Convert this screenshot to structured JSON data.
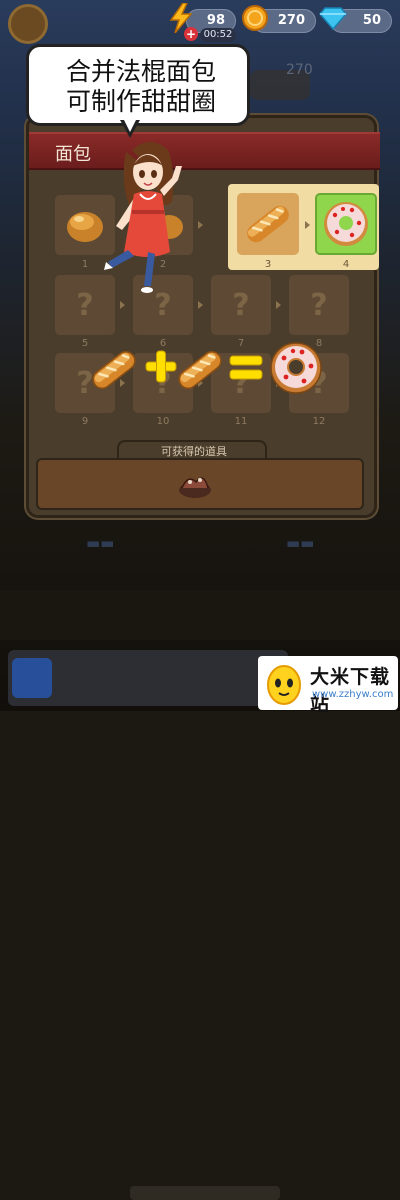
{
  "resources": {
    "energy": "98",
    "energy_timer": "00:52",
    "coins": "270",
    "gems": "50"
  },
  "background": {
    "hud_number": "270"
  },
  "panel": {
    "title": "面包",
    "slots": [
      {
        "num": "1",
        "item": "bun"
      },
      {
        "num": "2",
        "item": "bun"
      },
      {
        "num": "3",
        "item": "baguette"
      },
      {
        "num": "4",
        "item": "donut"
      },
      {
        "num": "5",
        "item": "locked",
        "text": "?"
      },
      {
        "num": "6",
        "item": "locked",
        "text": "?"
      },
      {
        "num": "7",
        "item": "locked",
        "text": "?"
      },
      {
        "num": "8",
        "item": "locked",
        "text": "?"
      },
      {
        "num": "9",
        "item": "locked",
        "text": "?"
      },
      {
        "num": "10",
        "item": "locked",
        "text": "?"
      },
      {
        "num": "11",
        "item": "locked",
        "text": "?"
      },
      {
        "num": "12",
        "item": "locked",
        "text": "?"
      }
    ],
    "reward_label": "可获得的道具"
  },
  "equation": {
    "plus": "+",
    "equals": "="
  },
  "bubble": {
    "line1": "合并法棍面包",
    "line2": "可制作甜甜圈"
  },
  "watermark": {
    "title": "大米下载站",
    "url": "www.zzhyw.com"
  },
  "colors": {
    "panel": "#4a3d2c",
    "header": "#7a2424",
    "highlight": "#f1dca4",
    "equation_yellow": "#ffdf00"
  }
}
